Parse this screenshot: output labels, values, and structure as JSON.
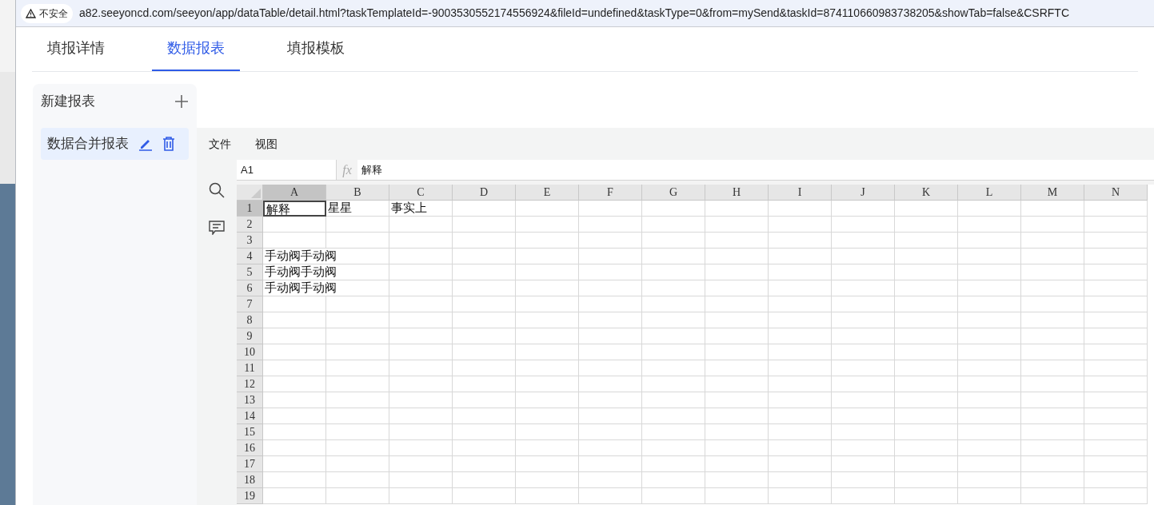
{
  "browser": {
    "security_label": "不安全",
    "url": "a82.seeyoncd.com/seeyon/app/dataTable/detail.html?taskTemplateId=-9003530552174556924&fileId=undefined&taskType=0&from=mySend&taskId=874110660983738205&showTab=false&CSRFTC"
  },
  "tabs": [
    {
      "label": "填报详情",
      "selected": false
    },
    {
      "label": "数据报表",
      "selected": true
    },
    {
      "label": "填报模板",
      "selected": false
    }
  ],
  "sidebar": {
    "new_report": "新建报表",
    "reports": [
      {
        "name": "数据合并报表",
        "selected": true
      }
    ]
  },
  "sheet": {
    "menu": [
      "文件",
      "视图"
    ],
    "name_box": "A1",
    "function_label": "fx",
    "formula": "解释",
    "columns": [
      {
        "label": "A",
        "selected": true
      },
      {
        "label": "B",
        "selected": false
      },
      {
        "label": "C",
        "selected": false
      },
      {
        "label": "D",
        "selected": false
      },
      {
        "label": "E",
        "selected": false
      },
      {
        "label": "F",
        "selected": false
      },
      {
        "label": "G",
        "selected": false
      },
      {
        "label": "H",
        "selected": false
      },
      {
        "label": "I",
        "selected": false
      },
      {
        "label": "J",
        "selected": false
      },
      {
        "label": "K",
        "selected": false
      },
      {
        "label": "L",
        "selected": false
      },
      {
        "label": "M",
        "selected": false
      },
      {
        "label": "N",
        "selected": false
      }
    ],
    "rows": [
      {
        "label": "1",
        "selected": true,
        "cells": [
          "解释",
          "星星",
          "事实上"
        ]
      },
      {
        "label": "2",
        "selected": false,
        "cells": []
      },
      {
        "label": "3",
        "selected": false,
        "cells": []
      },
      {
        "label": "4",
        "selected": false,
        "cells": [
          "手动阀手动阀"
        ]
      },
      {
        "label": "5",
        "selected": false,
        "cells": [
          "手动阀手动阀"
        ]
      },
      {
        "label": "6",
        "selected": false,
        "cells": [
          "手动阀手动阀"
        ]
      },
      {
        "label": "7",
        "selected": false,
        "cells": []
      },
      {
        "label": "8",
        "selected": false,
        "cells": []
      },
      {
        "label": "9",
        "selected": false,
        "cells": []
      },
      {
        "label": "10",
        "selected": false,
        "cells": []
      },
      {
        "label": "11",
        "selected": false,
        "cells": []
      },
      {
        "label": "12",
        "selected": false,
        "cells": []
      },
      {
        "label": "13",
        "selected": false,
        "cells": []
      },
      {
        "label": "14",
        "selected": false,
        "cells": []
      },
      {
        "label": "15",
        "selected": false,
        "cells": []
      },
      {
        "label": "16",
        "selected": false,
        "cells": []
      },
      {
        "label": "17",
        "selected": false,
        "cells": []
      },
      {
        "label": "18",
        "selected": false,
        "cells": []
      },
      {
        "label": "19",
        "selected": false,
        "cells": []
      }
    ]
  }
}
